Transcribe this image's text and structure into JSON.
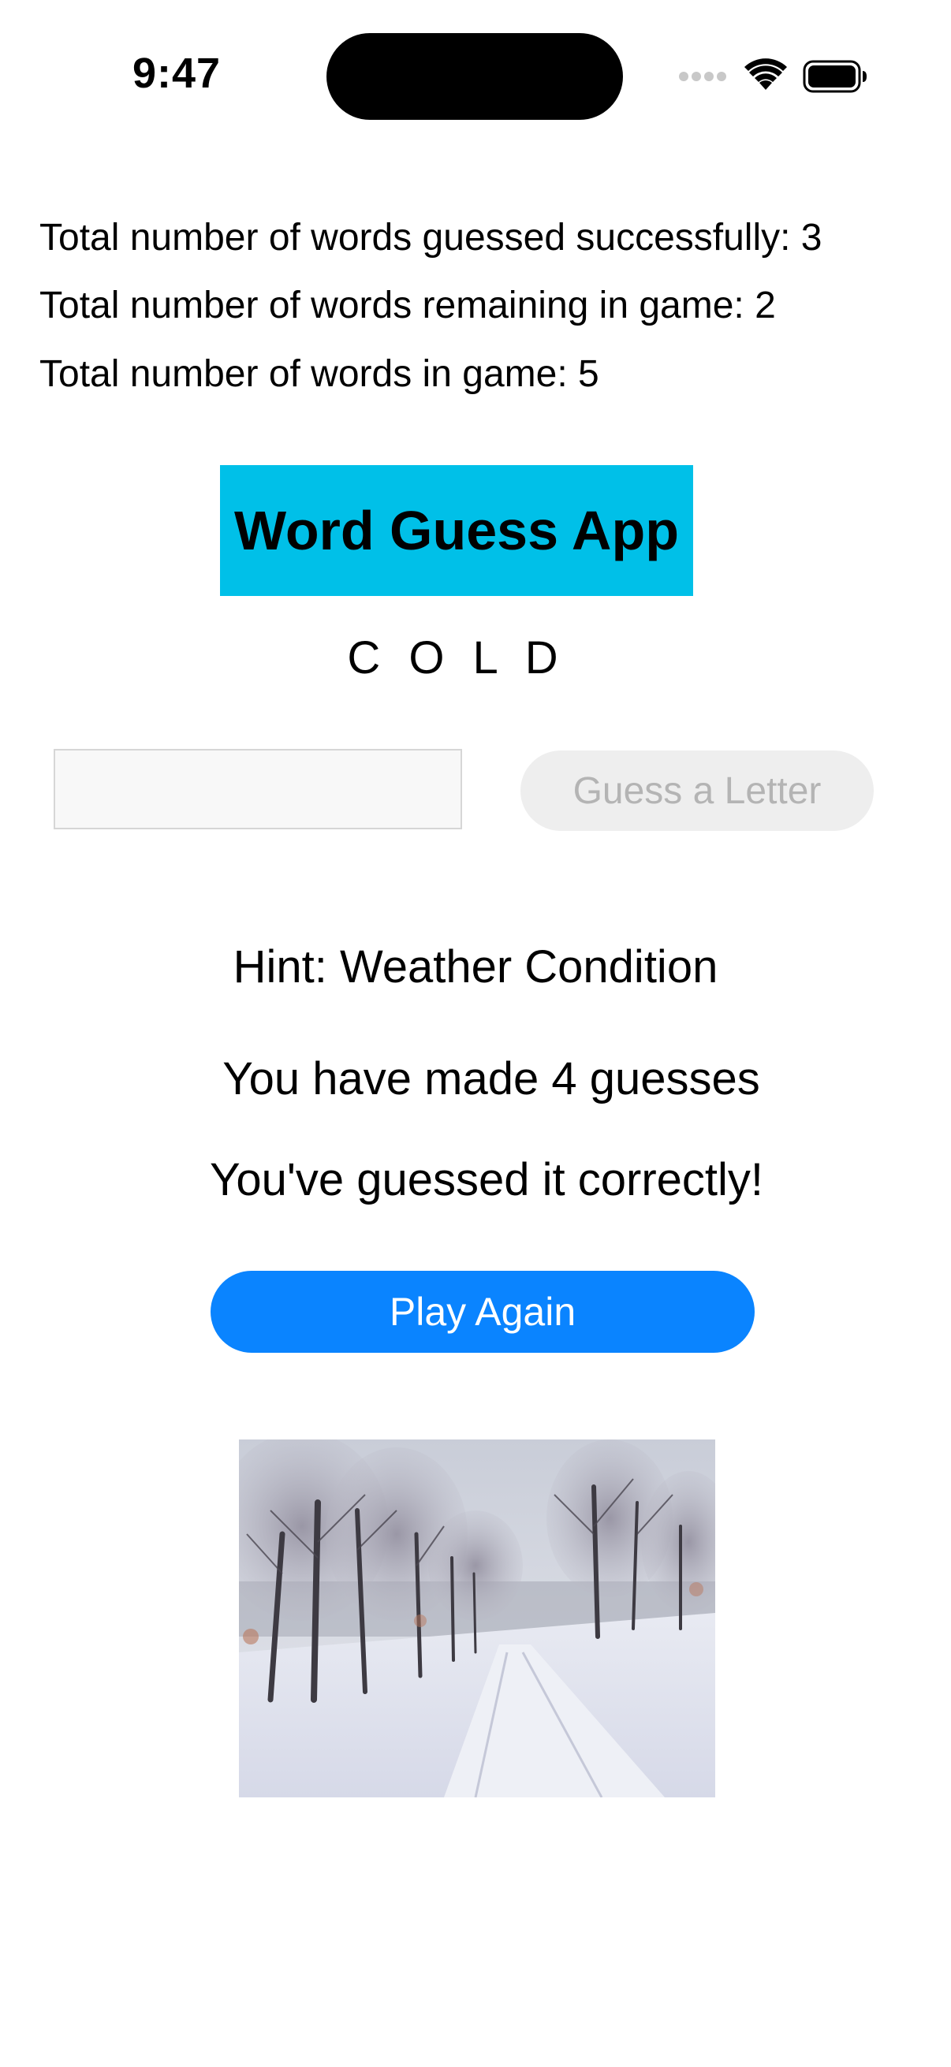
{
  "status_bar": {
    "time": "9:47",
    "icons": [
      "cellular-signal-icon",
      "wifi-icon",
      "battery-icon"
    ]
  },
  "stats": {
    "guessed_successfully": "Total number of words guessed successfully: 3",
    "remaining": "Total number of words remaining in game: 2",
    "total": "Total number of words in game: 5"
  },
  "title": "Word Guess App",
  "word_display": "C O L D",
  "input": {
    "value": "",
    "placeholder": ""
  },
  "guess_button_label": "Guess a Letter",
  "hint": "Hint: Weather Condition",
  "guess_count": "You have made 4 guesses",
  "result_message": "You've guessed it correctly!",
  "play_again_label": "Play Again",
  "colors": {
    "title_banner": "#00c0e8",
    "play_again": "#0a84ff",
    "guess_button_disabled_bg": "#eeeeee",
    "guess_button_disabled_text": "#b4b4b4"
  },
  "image": {
    "subject": "snowy-park-path"
  }
}
